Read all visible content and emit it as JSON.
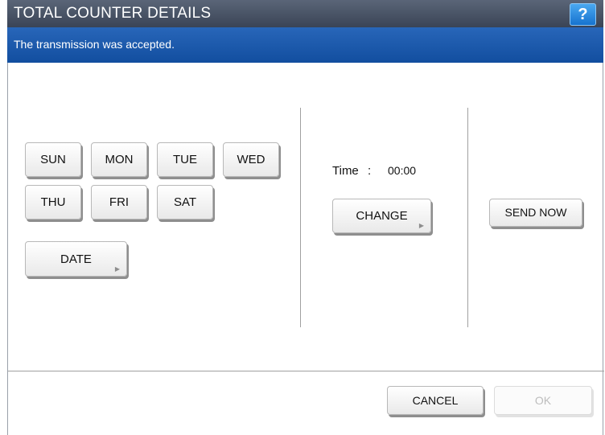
{
  "window": {
    "title": "TOTAL COUNTER DETAILS",
    "help_label": "?"
  },
  "status": {
    "message": "The transmission was accepted."
  },
  "days": [
    {
      "label": "SUN"
    },
    {
      "label": "MON"
    },
    {
      "label": "TUE"
    },
    {
      "label": "WED"
    },
    {
      "label": "THU"
    },
    {
      "label": "FRI"
    },
    {
      "label": "SAT"
    }
  ],
  "date_button": {
    "label": "DATE"
  },
  "time": {
    "label": "Time",
    "separator": ":",
    "value": "00:00"
  },
  "change_button": {
    "label": "CHANGE"
  },
  "send_now_button": {
    "label": "SEND NOW"
  },
  "footer": {
    "cancel_label": "CANCEL",
    "ok_label": "OK"
  },
  "icons": {
    "help": "question-mark-icon",
    "submenu": "triangle-right-icon"
  }
}
